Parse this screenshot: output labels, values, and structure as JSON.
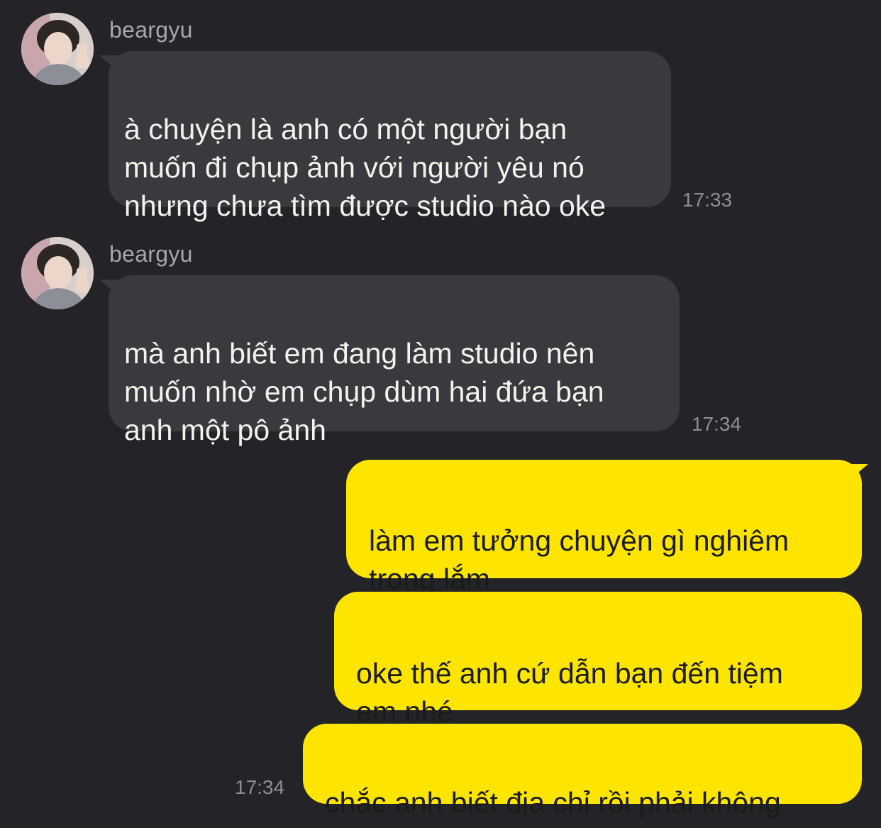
{
  "chat": {
    "messages": [
      {
        "direction": "incoming",
        "sender": "beargyu",
        "avatar_icon": "profile-photo",
        "text": "à chuyện là anh có một người bạn\nmuốn đi chụp ảnh với người yêu nó\nnhưng chưa tìm được studio nào oke",
        "time": "17:33"
      },
      {
        "direction": "incoming",
        "sender": "beargyu",
        "avatar_icon": "profile-photo",
        "text": "mà anh biết em đang làm studio nên\nmuốn nhờ em chụp dùm hai đứa bạn\nanh một pô ảnh",
        "time": "17:34"
      },
      {
        "direction": "outgoing",
        "text": "làm em tưởng chuyện gì nghiêm\ntrọng lắm"
      },
      {
        "direction": "outgoing",
        "text": "oke thế anh cứ dẫn bạn đến tiệm\nem nhé"
      },
      {
        "direction": "outgoing",
        "text": "chắc anh biết địa chỉ rồi phải không",
        "time": "17:34"
      }
    ]
  },
  "colors": {
    "background": "#242428",
    "incoming_bubble": "#3a3a3e",
    "outgoing_bubble": "#fde500",
    "timestamp": "#8e8e93",
    "sender_name": "#a7a7ab"
  }
}
